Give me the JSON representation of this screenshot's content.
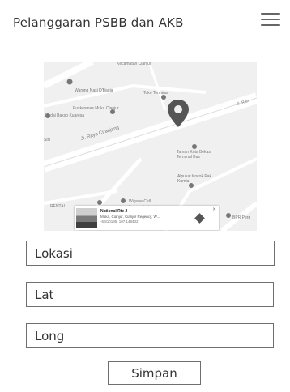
{
  "header": {
    "title": "Pelanggaran PSBB dan AKB",
    "menu_icon": "hamburger-menu-icon"
  },
  "map": {
    "labels": {
      "kecamatan": "Kecamatan Cianjur",
      "warung": "Warung Nasi D'Bagja",
      "toko": "Toko Terminal",
      "puskesmas": "Puskesmas Muka Cianjur",
      "bakso": "Kedai Bakso Kuaresa",
      "jalan_raya": "Jl. Raya Ciranjang",
      "jalan_ran": "Jl. Ran",
      "taman": "Taman Kota Bekas Terminal Bus",
      "alpukat": "Alpukat Kocok Pak Kurnia",
      "wigune": "Wigune Cell",
      "wigune_status": "Temporarily closed",
      "rental": "RENTAL",
      "bpr": "BPR Perg",
      "sisi": "Sisi"
    },
    "info_card": {
      "title": "National Rte 2",
      "subtitle": "Muka, Cianjur, Cianjur Regency, W...",
      "coords": "-6.810195, 107.148432",
      "close": "×"
    },
    "pin_color": "#555555"
  },
  "form": {
    "lokasi_placeholder": "Lokasi",
    "lat_placeholder": "Lat",
    "long_placeholder": "Long",
    "save_label": "Simpan"
  }
}
